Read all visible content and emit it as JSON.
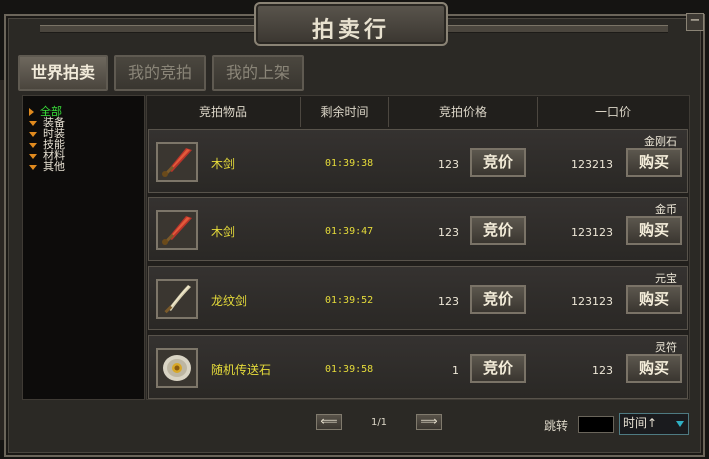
{
  "window": {
    "title": "拍卖行",
    "close_label": "−"
  },
  "tabs": [
    {
      "label": "世界拍卖",
      "active": true
    },
    {
      "label": "我的竞拍",
      "active": false
    },
    {
      "label": "我的上架",
      "active": false
    }
  ],
  "categories": [
    {
      "label": "全部",
      "selected": true
    },
    {
      "label": "装备",
      "selected": false
    },
    {
      "label": "时装",
      "selected": false
    },
    {
      "label": "技能",
      "selected": false
    },
    {
      "label": "材料",
      "selected": false
    },
    {
      "label": "其他",
      "selected": false
    }
  ],
  "table": {
    "headers": [
      "竞拍物品",
      "剩余时间",
      "竞拍价格",
      "一口价"
    ],
    "rows": [
      {
        "icon": "sword-icon",
        "name": "木剑",
        "time": "01:39:38",
        "bid_price": "123",
        "bid_label": "竞价",
        "buyout_price": "123213",
        "buy_label": "购买",
        "currency": "金刚石"
      },
      {
        "icon": "sword-icon",
        "name": "木剑",
        "time": "01:39:47",
        "bid_price": "123",
        "bid_label": "竞价",
        "buyout_price": "123123",
        "buy_label": "购买",
        "currency": "金币"
      },
      {
        "icon": "curved-blade-icon",
        "name": "龙纹剑",
        "time": "01:39:52",
        "bid_price": "123",
        "bid_label": "竞价",
        "buyout_price": "123123",
        "buy_label": "购买",
        "currency": "元宝"
      },
      {
        "icon": "teleport-stone-icon",
        "name": "随机传送石",
        "time": "01:39:58",
        "bid_price": "1",
        "bid_label": "竞价",
        "buyout_price": "123",
        "buy_label": "购买",
        "currency": "灵符"
      }
    ]
  },
  "pagination": {
    "prev_label": "⟸",
    "next_label": "⟹",
    "page": "1/1"
  },
  "jump": {
    "label": "跳转",
    "value": ""
  },
  "sort": {
    "selected": "时间↑"
  },
  "colors": {
    "item_name": "#e6dc3a",
    "selected_category": "#39e03a",
    "arrow": "#e08a1e"
  }
}
